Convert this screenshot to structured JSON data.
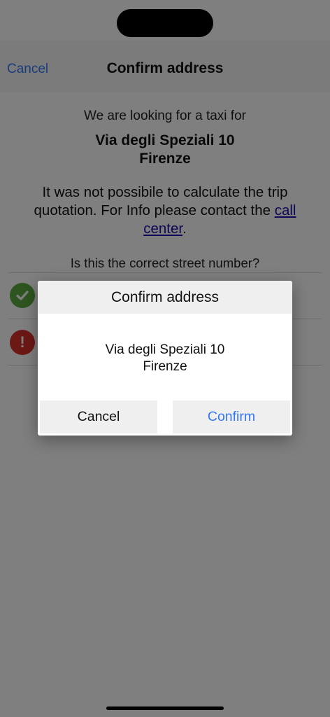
{
  "nav": {
    "cancel_label": "Cancel",
    "title": "Confirm address"
  },
  "content": {
    "looking_text": "We are looking for a taxi for",
    "street": "Via degli Speziali 10",
    "city": "Firenze",
    "message_before": "It was not possibile to calculate the trip quotation. For Info please contact the ",
    "message_link": "call center",
    "message_after": ".",
    "question": "Is this the correct street number?"
  },
  "options": {
    "yes_icon": "check-icon",
    "no_icon": "exclamation-icon",
    "yes_color": "#5dab3e",
    "no_color": "#d9302b"
  },
  "dialog": {
    "title": "Confirm address",
    "line1": "Via degli Speziali 10",
    "line2": "Firenze",
    "cancel_label": "Cancel",
    "confirm_label": "Confirm"
  },
  "colors": {
    "accent": "#3478f6",
    "link": "#1a0dab"
  }
}
